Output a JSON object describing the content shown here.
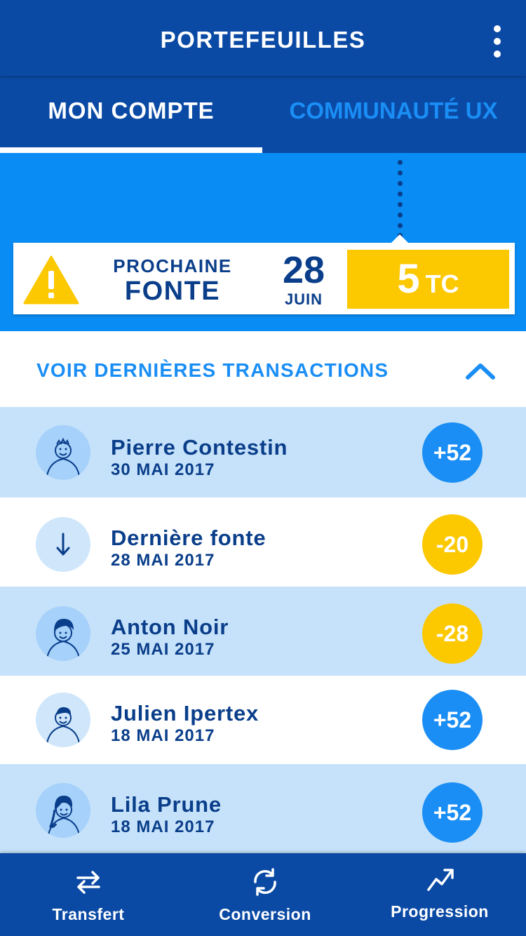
{
  "app": {
    "title": "PORTEFEUILLES",
    "accent": "#1a8ef5",
    "primary": "#0a4aa5",
    "warning": "#fcc800"
  },
  "tabs": [
    {
      "label": "MON COMPTE",
      "active": true
    },
    {
      "label": "COMMUNAUTÉ UX",
      "active": false
    }
  ],
  "next_melt": {
    "label_small": "PROCHAINE",
    "label_big": "FONTE",
    "day": "28",
    "month": "JUIN",
    "amount": "5",
    "unit": "TC",
    "icon": "warning-icon"
  },
  "transactions_toggle": {
    "label": "VOIR DERNIÈRES TRANSACTIONS",
    "icon": "chevron-up-icon"
  },
  "transactions": [
    {
      "name": "Pierre Contestin",
      "date": "30 MAI 2017",
      "amount": "+52",
      "type": "positive",
      "icon": "avatar-icon"
    },
    {
      "name": "Dernière fonte",
      "date": "28 MAI 2017",
      "amount": "-20",
      "type": "negative",
      "icon": "arrow-down-icon"
    },
    {
      "name": "Anton Noir",
      "date": "25 MAI 2017",
      "amount": "-28",
      "type": "negative",
      "icon": "avatar-icon"
    },
    {
      "name": "Julien Ipertex",
      "date": "18 MAI 2017",
      "amount": "+52",
      "type": "positive",
      "icon": "avatar-icon"
    },
    {
      "name": "Lila Prune",
      "date": "18 MAI 2017",
      "amount": "+52",
      "type": "positive",
      "icon": "avatar-icon"
    }
  ],
  "bottom_nav": [
    {
      "label": "Transfert",
      "icon": "transfer-icon"
    },
    {
      "label": "Conversion",
      "icon": "refresh-icon"
    },
    {
      "label": "Progression",
      "icon": "trending-up-icon"
    }
  ]
}
